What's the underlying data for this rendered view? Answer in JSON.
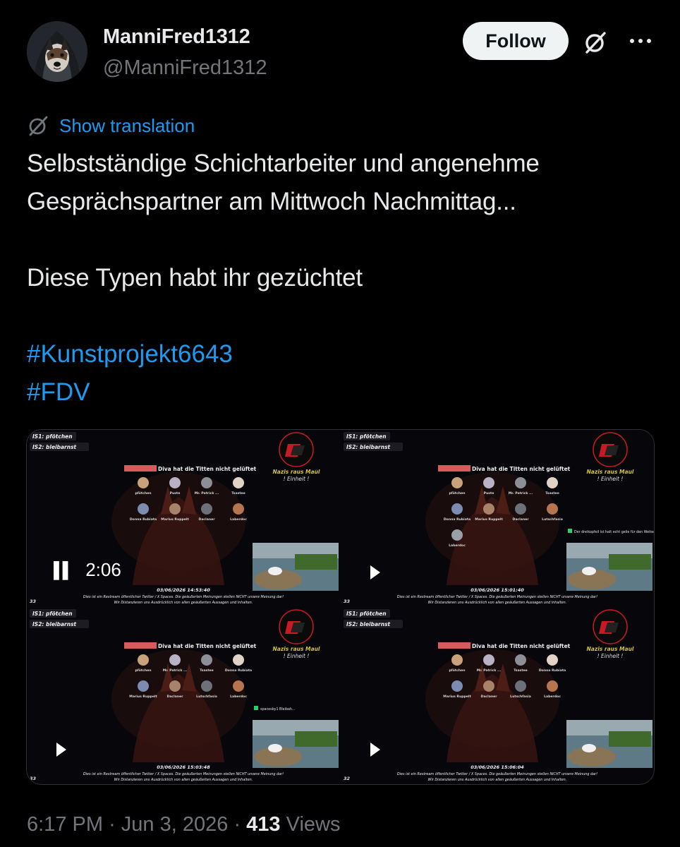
{
  "tweet": {
    "display_name": "ManniFred1312",
    "handle": "@ManniFred1312",
    "follow_label": "Follow",
    "translation_label": "Show translation",
    "text_line1": "Selbstständige Schichtarbeiter und angenehme",
    "text_line2": "Gesprächspartner am Mittwoch Nachmittag...",
    "text_line3": "Diese Typen habt ihr gezüchtet",
    "hashtags": [
      "#Kunstprojekt6643",
      "#FDV"
    ],
    "time": "6:17 PM",
    "date": "Jun 3, 2026",
    "sep": "·",
    "views_count": "413",
    "views_label": "Views"
  },
  "video": {
    "elapsed": "2:06",
    "tiles": [
      {
        "room_title": "Diva hat die Titten nicht gelüftet",
        "user1": "IS1: pfötchen",
        "user2": "IS2: bleibarnst",
        "timestamp": "03/06/2026 14:53:40",
        "viewer_count": "33",
        "sticker_line1": "Nazis raus Maul",
        "sticker_line2": "! Einheit !",
        "participants": [
          "pfötchen",
          "Puste",
          "Mr. Patrick ...",
          "Tsastee",
          "Donna Rubiata",
          "Marius Ruppelt",
          "Daclaner",
          "Laberdoc"
        ],
        "disclaimer_line1": "Dies ist ein Restream öffentlicher Twitter / X Spaces. Die geäußerten Meinungen stellen NICHT unsere Meinung dar!",
        "disclaimer_line2": "Wir Distanzieren uns Ausdrücklich von allen geäußerten Aussagen und Inhalten."
      },
      {
        "room_title": "Diva hat die Titten nicht gelüftet",
        "user1": "IS1: pfötchen",
        "user2": "IS2: bleibarnst",
        "timestamp": "03/06/2026 15:01:40",
        "viewer_count": "33",
        "sticker_line1": "Nazis raus Maul",
        "sticker_line2": "! Einheit !",
        "participants": [
          "pfötchen",
          "Puste",
          "Mr. Patrick ...",
          "Tsastee",
          "Donna Rubiata",
          "Marius Ruppelt",
          "Daclaner",
          "Lutschfasia",
          "Laberdoc"
        ],
        "chat_text": "Der dreikopfeil ist halt echt geile für den Weiter...",
        "disclaimer_line1": "Dies ist ein Restream öffentlicher Twitter / X Spaces. Die geäußerten Meinungen stellen NICHT unsere Meinung dar!",
        "disclaimer_line2": "Wir Distanzieren uns Ausdrücklich von allen geäußerten Aussagen und Inhalten."
      },
      {
        "room_title": "Diva hat die Titten nicht gelüftet",
        "user1": "IS1: pfötchen",
        "user2": "IS2: bleibarnst",
        "timestamp": "03/06/2026 15:03:48",
        "viewer_count": "33",
        "sticker_line1": "Nazis raus Maul",
        "sticker_line2": "! Einheit !",
        "participants": [
          "pfötchen",
          "Mr. Patrick ...",
          "Tsastee",
          "Donna Rubiata",
          "Marius Ruppelt",
          "Daclaner",
          "Lutschfasia",
          "Laberdoc"
        ],
        "chat_text": "spacesby1 Bleibah...",
        "disclaimer_line1": "Dies ist ein Restream öffentlicher Twitter / X Spaces. Die geäußerten Meinungen stellen NICHT unsere Meinung dar!",
        "disclaimer_line2": "Wir Distanzieren uns Ausdrücklich von allen geäußerten Aussagen und Inhalten."
      },
      {
        "room_title": "Diva hat die Titten nicht gelüftet",
        "user1": "IS1: pfötchen",
        "user2": "IS2: bleibarnst",
        "timestamp": "03/06/2026 15:06:04",
        "viewer_count": "32",
        "sticker_line1": "Nazis raus Maul",
        "sticker_line2": "! Einheit !",
        "participants": [
          "pfötchen",
          "Mr. Patrick ...",
          "Tsastee",
          "Donna Rubiata",
          "Marius Ruppelt",
          "Daclaner",
          "Lutschfasia",
          "Laberdoc"
        ],
        "disclaimer_line1": "Dies ist ein Restream öffentlicher Twitter / X Spaces. Die geäußerten Meinungen stellen NICHT unsere Meinung dar!",
        "disclaimer_line2": "Wir Distanzieren uns Ausdrücklich von allen geäußerten Aussagen und Inhalten."
      }
    ]
  },
  "colors": {
    "accent": "#1d9bf0",
    "follow_bg": "#eff3f4",
    "text": "#e7e9ea",
    "muted": "#71767b",
    "antifa_red": "#c81a24"
  },
  "icons": {
    "avatar": "dog-in-hoodie-avatar",
    "grok": "grok-icon",
    "more": "more-dots-icon",
    "translate": "translate-icon",
    "pause": "pause-icon",
    "play": "play-icon"
  }
}
